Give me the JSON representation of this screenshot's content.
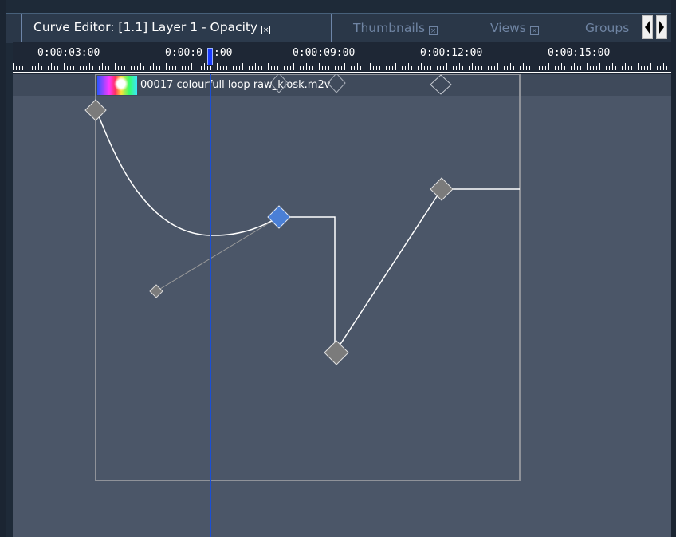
{
  "tabs": [
    {
      "label": "Curve Editor: [1.1] Layer 1 - Opacity",
      "active": true
    },
    {
      "label": "Thumbnails",
      "active": false
    },
    {
      "label": "Views",
      "active": false
    },
    {
      "label": "Groups",
      "active": false
    }
  ],
  "tab_close_glyph": "⊠",
  "ruler": {
    "labels": [
      "0:00:03:00",
      "0:00:0",
      ":00",
      "0:00:09:00",
      "0:00:12:00",
      "0:00:15:00"
    ]
  },
  "clip": {
    "name": "00017 colourfull loop raw_kiosk.m2v"
  },
  "colors": {
    "background": "#4b5668",
    "playhead": "#1a4fd6",
    "selected_keyframe": "#4a7fd6",
    "keyframe": "#7a7a7a",
    "curve": "#ffffff"
  },
  "icons": {
    "scroll_left": "triangle-left-icon",
    "scroll_right": "triangle-right-icon"
  }
}
